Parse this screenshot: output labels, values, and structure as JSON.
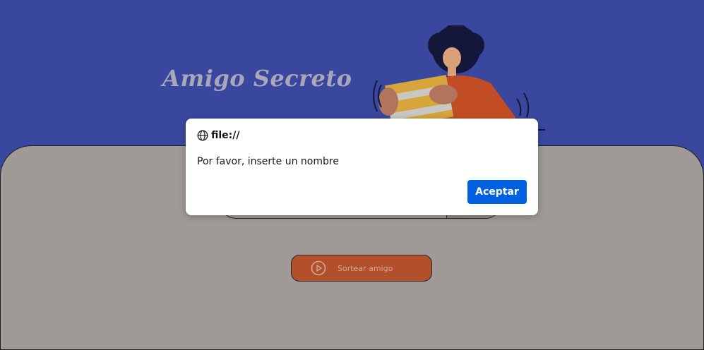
{
  "page": {
    "title": "Amigo Secreto",
    "draw_button_label": "Sortear amigo"
  },
  "dialog": {
    "origin": "file://",
    "message": "Por favor, inserte un nombre",
    "accept_label": "Aceptar"
  },
  "colors": {
    "background": "#3a479f",
    "panel": "#9f9a95",
    "draw_button": "#b2502b",
    "dialog_button": "#0060df"
  }
}
